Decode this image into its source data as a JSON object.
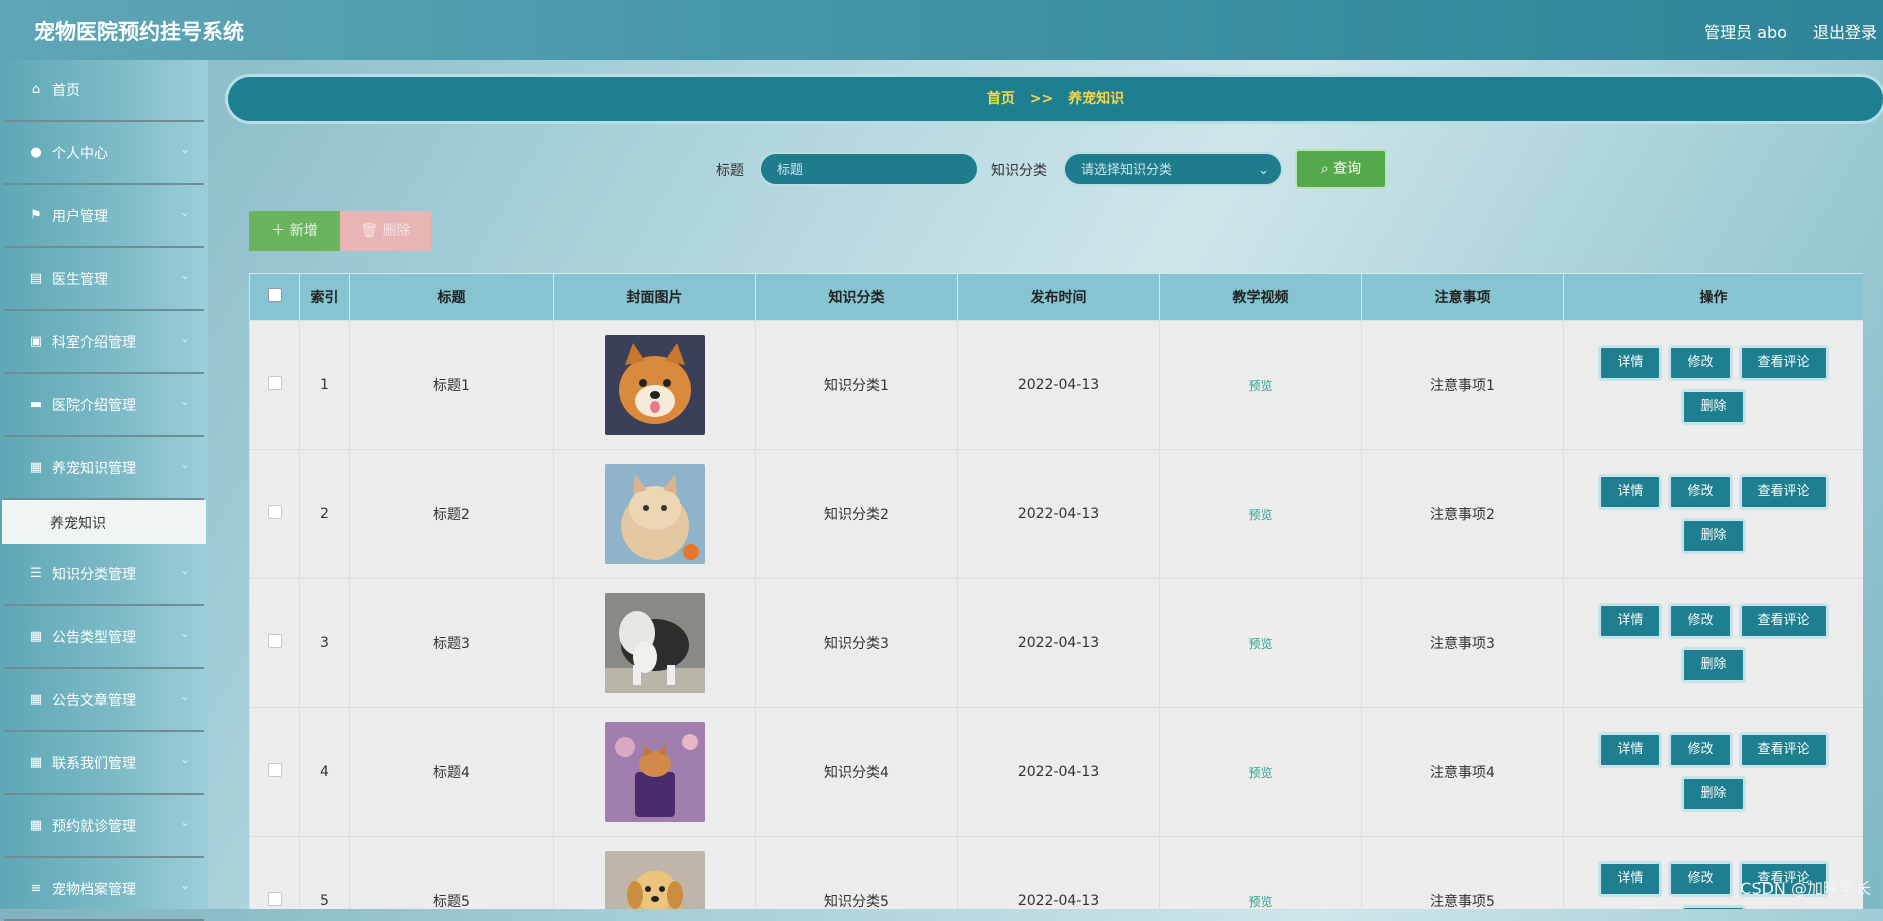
{
  "header": {
    "title": "宠物医院预约挂号系统",
    "admin": "管理员 abo",
    "logout": "退出登录"
  },
  "sidebar": {
    "items": [
      {
        "label": "首页",
        "icon": "home-icon",
        "glyph": "⌂",
        "chevron": false
      },
      {
        "label": "个人中心",
        "icon": "user-icon",
        "glyph": "●",
        "chevron": true
      },
      {
        "label": "用户管理",
        "icon": "flag-icon",
        "glyph": "⚑",
        "chevron": true
      },
      {
        "label": "医生管理",
        "icon": "clipboard-icon",
        "glyph": "▤",
        "chevron": true
      },
      {
        "label": "科室介绍管理",
        "icon": "clipboard-check-icon",
        "glyph": "▣",
        "chevron": true
      },
      {
        "label": "医院介绍管理",
        "icon": "ticket-icon",
        "glyph": "▬",
        "chevron": true
      },
      {
        "label": "养宠知识管理",
        "icon": "grid-icon",
        "glyph": "▦",
        "chevron": true
      },
      {
        "label": "知识分类管理",
        "icon": "list-icon",
        "glyph": "☰",
        "chevron": true
      },
      {
        "label": "公告类型管理",
        "icon": "grid-icon",
        "glyph": "▦",
        "chevron": true
      },
      {
        "label": "公告文章管理",
        "icon": "grid-icon",
        "glyph": "▦",
        "chevron": true
      },
      {
        "label": "联系我们管理",
        "icon": "grid-icon",
        "glyph": "▦",
        "chevron": true
      },
      {
        "label": "预约就诊管理",
        "icon": "grid-icon",
        "glyph": "▦",
        "chevron": true
      },
      {
        "label": "宠物档案管理",
        "icon": "sliders-icon",
        "glyph": "≡",
        "chevron": true
      }
    ],
    "submenu": "养宠知识"
  },
  "breadcrumb": {
    "home": "首页",
    "sep": ">>",
    "current": "养宠知识"
  },
  "search": {
    "title_label": "标题",
    "title_placeholder": "标题",
    "category_label": "知识分类",
    "category_placeholder": "请选择知识分类",
    "button": "查询"
  },
  "actions": {
    "add": "新增",
    "delete": "删除"
  },
  "table": {
    "headers": [
      "索引",
      "标题",
      "封面图片",
      "知识分类",
      "发布时间",
      "教学视频",
      "注意事项",
      "操作"
    ],
    "rows": [
      {
        "index": "1",
        "title": "标题1",
        "category": "知识分类1",
        "date": "2022-04-13",
        "video": "预览",
        "note": "注意事项1",
        "image": "shiba-dog"
      },
      {
        "index": "2",
        "title": "标题2",
        "category": "知识分类2",
        "date": "2022-04-13",
        "video": "预览",
        "note": "注意事项2",
        "image": "fluffy-cat"
      },
      {
        "index": "3",
        "title": "标题3",
        "category": "知识分类3",
        "date": "2022-04-13",
        "video": "预览",
        "note": "注意事项3",
        "image": "sheepdog"
      },
      {
        "index": "4",
        "title": "标题4",
        "category": "知识分类4",
        "date": "2022-04-13",
        "video": "预览",
        "note": "注意事项4",
        "image": "kitten-in-bag"
      },
      {
        "index": "5",
        "title": "标题5",
        "category": "知识分类5",
        "date": "2022-04-13",
        "video": "预览",
        "note": "注意事项5",
        "image": "retriever-puppy"
      }
    ],
    "ops": {
      "detail": "详情",
      "edit": "修改",
      "comments": "查看评论",
      "delete": "删除"
    }
  },
  "watermark": "CSDN @加映学长",
  "colors": {
    "primary": "#1d7f8f",
    "breadcrumb_text": "#f5d74a",
    "search_button": "#54a94a",
    "add_button": "#6ab45e",
    "delete_button": "#e8b4b4",
    "header_bg": "#86c4d1"
  }
}
